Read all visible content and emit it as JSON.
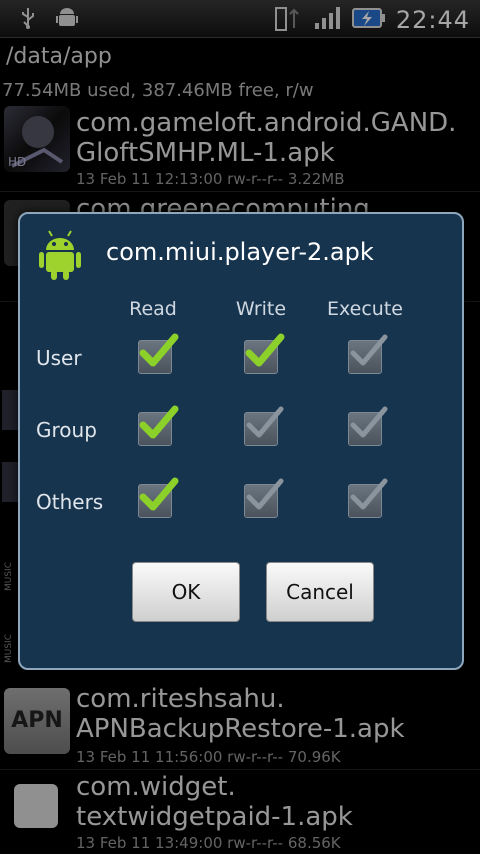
{
  "status": {
    "time": "22:44"
  },
  "header": {
    "path": "/data/app",
    "usage": "77.54MB used, 387.46MB free, r/w"
  },
  "files": [
    {
      "name1": "com.gameloft.android.GAND.",
      "name2": "GloftSMHP.ML-1.apk",
      "meta": "13 Feb 11 12:13:00  rw-r--r--  3.22MB"
    },
    {
      "name1": "com.greenecomputing",
      "name2": "",
      "meta": ""
    },
    {
      "name1": "com.riteshsahu.",
      "name2": "APNBackupRestore-1.apk",
      "meta": "13 Feb 11 11:56:00  rw-r--r--  70.96K",
      "thumb": "APN"
    },
    {
      "name1": "com.widget.",
      "name2": "textwidgetpaid-1.apk",
      "meta": "13 Feb 11 13:49:00  rw-r--r--  68.56K"
    }
  ],
  "left_labels": [
    "MUSIC",
    "MUSIC"
  ],
  "dialog": {
    "title": "com.miui.player-2.apk",
    "columns": [
      "Read",
      "Write",
      "Execute"
    ],
    "rows": [
      {
        "label": "User",
        "checks": [
          true,
          true,
          false
        ]
      },
      {
        "label": "Group",
        "checks": [
          true,
          false,
          false
        ]
      },
      {
        "label": "Others",
        "checks": [
          true,
          false,
          false
        ]
      }
    ],
    "ok_label": "OK",
    "cancel_label": "Cancel"
  },
  "colors": {
    "check_on": "#8cd12a",
    "check_off": "#8a949d",
    "dialog_bg": "#17344f"
  }
}
